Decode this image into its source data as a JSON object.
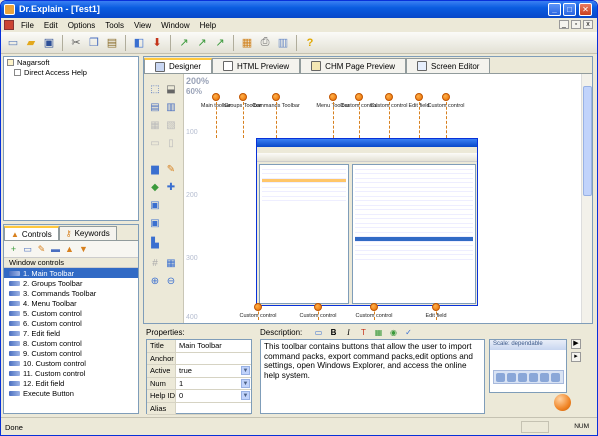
{
  "window": {
    "title": "Dr.Explain - [Test1]"
  },
  "menu": [
    "File",
    "Edit",
    "Options",
    "Tools",
    "View",
    "Window",
    "Help"
  ],
  "tree": {
    "root": "Nagarsoft",
    "child": "Direct Access Help"
  },
  "left_tabs": {
    "controls": "Controls",
    "keywords": "Keywords"
  },
  "controls_list": {
    "header": "Window controls",
    "items": [
      "1. Main Toolbar",
      "2. Groups Toolbar",
      "3. Commands Toolbar",
      "4. Menu Toolbar",
      "5. Custom control",
      "6. Custom control",
      "7. Edit field",
      "8. Custom control",
      "9. Custom control",
      "10. Custom control",
      "11. Custom control",
      "12. Edit field",
      "Execute Button"
    ],
    "selected_index": 0
  },
  "designer_tabs": [
    "Designer",
    "HTML Preview",
    "CHM Page Preview",
    "Screen Editor"
  ],
  "canvas": {
    "zoom_label": "200%",
    "zoom_pct": "60%",
    "ruler": [
      "100",
      "200",
      "300",
      "400"
    ],
    "callouts_top": [
      "Main toolbar",
      "Groups Toolbar",
      "Commands Toolbar",
      "Menu Toolbar",
      "Custom control",
      "Custom control",
      "Edit field",
      "Custom control"
    ],
    "callouts_bottom": [
      "Custom control",
      "Custom control",
      "Custom control",
      "Edit field"
    ]
  },
  "properties": {
    "label": "Properties:",
    "rows": [
      {
        "key": "Title",
        "value": "Main Toolbar",
        "dropdown": false
      },
      {
        "key": "Anchor",
        "value": "",
        "dropdown": false
      },
      {
        "key": "Active",
        "value": "true",
        "dropdown": true
      },
      {
        "key": "Num",
        "value": "1",
        "dropdown": true
      },
      {
        "key": "Help ID",
        "value": "0",
        "dropdown": true
      },
      {
        "key": "Alias",
        "value": "",
        "dropdown": false
      }
    ]
  },
  "description": {
    "label": "Description:",
    "text": "This toolbar contains buttons that allow the user to import command packs, export command packs,edit options and settings, open Windows Explorer, and access the online help system."
  },
  "preview": {
    "caption": "Scale: dependable"
  },
  "status": {
    "left": "Done",
    "right": "NUM"
  }
}
